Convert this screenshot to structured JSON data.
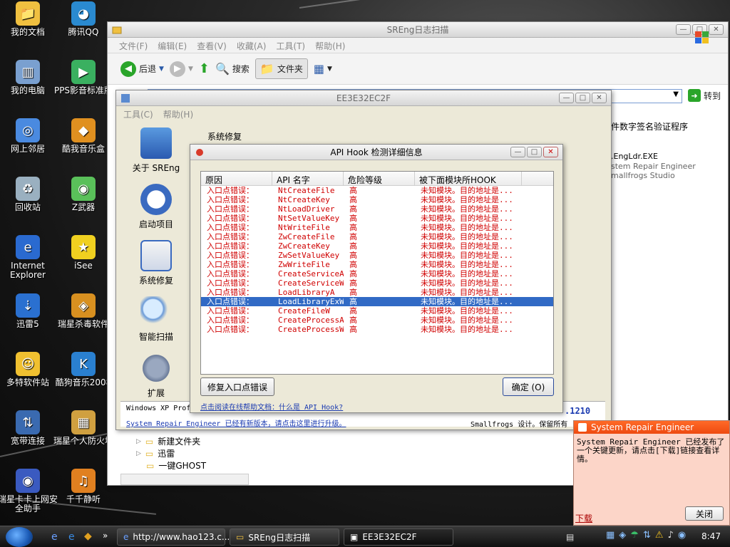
{
  "desktop": {
    "icons": [
      {
        "label": "我的文档"
      },
      {
        "label": "腾讯QQ"
      },
      {
        "label": "我的电脑"
      },
      {
        "label": "PPS影音标准版"
      },
      {
        "label": "网上邻居"
      },
      {
        "label": "酷我音乐盒"
      },
      {
        "label": "回收站"
      },
      {
        "label": "Z武器"
      },
      {
        "label": "Internet Explorer"
      },
      {
        "label": "iSee"
      },
      {
        "label": "迅雷5"
      },
      {
        "label": "瑞星杀毒软件"
      },
      {
        "label": "多特软件站"
      },
      {
        "label": "酷狗音乐2008"
      },
      {
        "label": "宽带连接"
      },
      {
        "label": "瑞星个人防火墙"
      },
      {
        "label": "瑞星卡卡上网安全助手"
      },
      {
        "label": "千千静听"
      }
    ]
  },
  "explorer": {
    "title": "SREng日志扫描",
    "menu": [
      "文件(F)",
      "编辑(E)",
      "查看(V)",
      "收藏(A)",
      "工具(T)",
      "帮助(H)"
    ],
    "toolbar": {
      "back": "后退",
      "search": "搜索",
      "folders": "文件夹",
      "go": "转到"
    },
    "right_text": [
      "件数字签名验证程序",
      ".EngLdr.EXE",
      "stem Repair Engineer",
      "mallfrogs Studio"
    ],
    "version": ".1210",
    "footer_right": "Smallfrogs 设计。保留所有",
    "tree": [
      "新建文件夹",
      "迅雷",
      "一键GHOST"
    ]
  },
  "sreng": {
    "title": "EE3E32EC2F",
    "menu": [
      "工具(C)",
      "帮助(H)"
    ],
    "nav": [
      {
        "label": "关于 SREng"
      },
      {
        "label": "启动项目"
      },
      {
        "label": "系统修复"
      },
      {
        "label": "智能扫描"
      },
      {
        "label": "扩展"
      }
    ],
    "section_title": "系统修复",
    "os_text": "Windows XP Prof",
    "update_link": "System Repair Engineer 已经有新版本，请点击这里进行升级。"
  },
  "api_dialog": {
    "title": "API Hook 检测详细信息",
    "columns": [
      "原因",
      "API 名字",
      "危险等级",
      "被下面模块所HOOK"
    ],
    "rows": [
      {
        "reason": "入口点错误：",
        "api": "NtCreateFile",
        "level": "高",
        "module": "未知模块。目的地址是..."
      },
      {
        "reason": "入口点错误：",
        "api": "NtCreateKey",
        "level": "高",
        "module": "未知模块。目的地址是..."
      },
      {
        "reason": "入口点错误：",
        "api": "NtLoadDriver",
        "level": "高",
        "module": "未知模块。目的地址是..."
      },
      {
        "reason": "入口点错误：",
        "api": "NtSetValueKey",
        "level": "高",
        "module": "未知模块。目的地址是..."
      },
      {
        "reason": "入口点错误：",
        "api": "NtWriteFile",
        "level": "高",
        "module": "未知模块。目的地址是..."
      },
      {
        "reason": "入口点错误：",
        "api": "ZwCreateFile",
        "level": "高",
        "module": "未知模块。目的地址是..."
      },
      {
        "reason": "入口点错误：",
        "api": "ZwCreateKey",
        "level": "高",
        "module": "未知模块。目的地址是..."
      },
      {
        "reason": "入口点错误：",
        "api": "ZwSetValueKey",
        "level": "高",
        "module": "未知模块。目的地址是..."
      },
      {
        "reason": "入口点错误：",
        "api": "ZwWriteFile",
        "level": "高",
        "module": "未知模块。目的地址是..."
      },
      {
        "reason": "入口点错误：",
        "api": "CreateServiceA",
        "level": "高",
        "module": "未知模块。目的地址是..."
      },
      {
        "reason": "入口点错误：",
        "api": "CreateServiceW",
        "level": "高",
        "module": "未知模块。目的地址是..."
      },
      {
        "reason": "入口点错误：",
        "api": "LoadLibraryA",
        "level": "高",
        "module": "未知模块。目的地址是..."
      },
      {
        "reason": "入口点错误：",
        "api": "LoadLibraryExW",
        "level": "高",
        "module": "未知模块。目的地址是..."
      },
      {
        "reason": "入口点错误：",
        "api": "CreateFileW",
        "level": "高",
        "module": "未知模块。目的地址是..."
      },
      {
        "reason": "入口点错误：",
        "api": "CreateProcessA",
        "level": "高",
        "module": "未知模块。目的地址是..."
      },
      {
        "reason": "入口点错误：",
        "api": "CreateProcessW",
        "level": "高",
        "module": "未知模块。目的地址是..."
      }
    ],
    "selected_index": 12,
    "fix_button": "修复入口点错误",
    "ok_button": "确定 (O)",
    "help_link": "点击阅读在线帮助文档：什么是 API Hook?"
  },
  "notification": {
    "title": "System Repair Engineer",
    "body": "System Repair Engineer 已经发布了一个关键更新，请点击[下载]链接查看详情。",
    "download": "下载",
    "close": "关闭"
  },
  "taskbar": {
    "tasks": [
      "http://www.hao123.c...",
      "SREng日志扫描",
      "EE3E32EC2F"
    ],
    "clock": "8:47"
  },
  "colors": {
    "error_text": "#d00000",
    "selection": "#316ac5",
    "notify_bg": "#fcd5c8"
  }
}
